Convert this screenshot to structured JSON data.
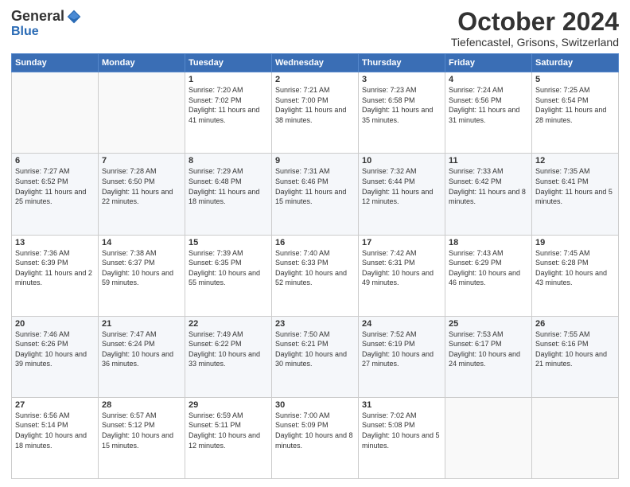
{
  "logo": {
    "general": "General",
    "blue": "Blue"
  },
  "header": {
    "month": "October 2024",
    "location": "Tiefencastel, Grisons, Switzerland"
  },
  "weekdays": [
    "Sunday",
    "Monday",
    "Tuesday",
    "Wednesday",
    "Thursday",
    "Friday",
    "Saturday"
  ],
  "weeks": [
    [
      {
        "day": "",
        "sunrise": "",
        "sunset": "",
        "daylight": ""
      },
      {
        "day": "",
        "sunrise": "",
        "sunset": "",
        "daylight": ""
      },
      {
        "day": "1",
        "sunrise": "Sunrise: 7:20 AM",
        "sunset": "Sunset: 7:02 PM",
        "daylight": "Daylight: 11 hours and 41 minutes."
      },
      {
        "day": "2",
        "sunrise": "Sunrise: 7:21 AM",
        "sunset": "Sunset: 7:00 PM",
        "daylight": "Daylight: 11 hours and 38 minutes."
      },
      {
        "day": "3",
        "sunrise": "Sunrise: 7:23 AM",
        "sunset": "Sunset: 6:58 PM",
        "daylight": "Daylight: 11 hours and 35 minutes."
      },
      {
        "day": "4",
        "sunrise": "Sunrise: 7:24 AM",
        "sunset": "Sunset: 6:56 PM",
        "daylight": "Daylight: 11 hours and 31 minutes."
      },
      {
        "day": "5",
        "sunrise": "Sunrise: 7:25 AM",
        "sunset": "Sunset: 6:54 PM",
        "daylight": "Daylight: 11 hours and 28 minutes."
      }
    ],
    [
      {
        "day": "6",
        "sunrise": "Sunrise: 7:27 AM",
        "sunset": "Sunset: 6:52 PM",
        "daylight": "Daylight: 11 hours and 25 minutes."
      },
      {
        "day": "7",
        "sunrise": "Sunrise: 7:28 AM",
        "sunset": "Sunset: 6:50 PM",
        "daylight": "Daylight: 11 hours and 22 minutes."
      },
      {
        "day": "8",
        "sunrise": "Sunrise: 7:29 AM",
        "sunset": "Sunset: 6:48 PM",
        "daylight": "Daylight: 11 hours and 18 minutes."
      },
      {
        "day": "9",
        "sunrise": "Sunrise: 7:31 AM",
        "sunset": "Sunset: 6:46 PM",
        "daylight": "Daylight: 11 hours and 15 minutes."
      },
      {
        "day": "10",
        "sunrise": "Sunrise: 7:32 AM",
        "sunset": "Sunset: 6:44 PM",
        "daylight": "Daylight: 11 hours and 12 minutes."
      },
      {
        "day": "11",
        "sunrise": "Sunrise: 7:33 AM",
        "sunset": "Sunset: 6:42 PM",
        "daylight": "Daylight: 11 hours and 8 minutes."
      },
      {
        "day": "12",
        "sunrise": "Sunrise: 7:35 AM",
        "sunset": "Sunset: 6:41 PM",
        "daylight": "Daylight: 11 hours and 5 minutes."
      }
    ],
    [
      {
        "day": "13",
        "sunrise": "Sunrise: 7:36 AM",
        "sunset": "Sunset: 6:39 PM",
        "daylight": "Daylight: 11 hours and 2 minutes."
      },
      {
        "day": "14",
        "sunrise": "Sunrise: 7:38 AM",
        "sunset": "Sunset: 6:37 PM",
        "daylight": "Daylight: 10 hours and 59 minutes."
      },
      {
        "day": "15",
        "sunrise": "Sunrise: 7:39 AM",
        "sunset": "Sunset: 6:35 PM",
        "daylight": "Daylight: 10 hours and 55 minutes."
      },
      {
        "day": "16",
        "sunrise": "Sunrise: 7:40 AM",
        "sunset": "Sunset: 6:33 PM",
        "daylight": "Daylight: 10 hours and 52 minutes."
      },
      {
        "day": "17",
        "sunrise": "Sunrise: 7:42 AM",
        "sunset": "Sunset: 6:31 PM",
        "daylight": "Daylight: 10 hours and 49 minutes."
      },
      {
        "day": "18",
        "sunrise": "Sunrise: 7:43 AM",
        "sunset": "Sunset: 6:29 PM",
        "daylight": "Daylight: 10 hours and 46 minutes."
      },
      {
        "day": "19",
        "sunrise": "Sunrise: 7:45 AM",
        "sunset": "Sunset: 6:28 PM",
        "daylight": "Daylight: 10 hours and 43 minutes."
      }
    ],
    [
      {
        "day": "20",
        "sunrise": "Sunrise: 7:46 AM",
        "sunset": "Sunset: 6:26 PM",
        "daylight": "Daylight: 10 hours and 39 minutes."
      },
      {
        "day": "21",
        "sunrise": "Sunrise: 7:47 AM",
        "sunset": "Sunset: 6:24 PM",
        "daylight": "Daylight: 10 hours and 36 minutes."
      },
      {
        "day": "22",
        "sunrise": "Sunrise: 7:49 AM",
        "sunset": "Sunset: 6:22 PM",
        "daylight": "Daylight: 10 hours and 33 minutes."
      },
      {
        "day": "23",
        "sunrise": "Sunrise: 7:50 AM",
        "sunset": "Sunset: 6:21 PM",
        "daylight": "Daylight: 10 hours and 30 minutes."
      },
      {
        "day": "24",
        "sunrise": "Sunrise: 7:52 AM",
        "sunset": "Sunset: 6:19 PM",
        "daylight": "Daylight: 10 hours and 27 minutes."
      },
      {
        "day": "25",
        "sunrise": "Sunrise: 7:53 AM",
        "sunset": "Sunset: 6:17 PM",
        "daylight": "Daylight: 10 hours and 24 minutes."
      },
      {
        "day": "26",
        "sunrise": "Sunrise: 7:55 AM",
        "sunset": "Sunset: 6:16 PM",
        "daylight": "Daylight: 10 hours and 21 minutes."
      }
    ],
    [
      {
        "day": "27",
        "sunrise": "Sunrise: 6:56 AM",
        "sunset": "Sunset: 5:14 PM",
        "daylight": "Daylight: 10 hours and 18 minutes."
      },
      {
        "day": "28",
        "sunrise": "Sunrise: 6:57 AM",
        "sunset": "Sunset: 5:12 PM",
        "daylight": "Daylight: 10 hours and 15 minutes."
      },
      {
        "day": "29",
        "sunrise": "Sunrise: 6:59 AM",
        "sunset": "Sunset: 5:11 PM",
        "daylight": "Daylight: 10 hours and 12 minutes."
      },
      {
        "day": "30",
        "sunrise": "Sunrise: 7:00 AM",
        "sunset": "Sunset: 5:09 PM",
        "daylight": "Daylight: 10 hours and 8 minutes."
      },
      {
        "day": "31",
        "sunrise": "Sunrise: 7:02 AM",
        "sunset": "Sunset: 5:08 PM",
        "daylight": "Daylight: 10 hours and 5 minutes."
      },
      {
        "day": "",
        "sunrise": "",
        "sunset": "",
        "daylight": ""
      },
      {
        "day": "",
        "sunrise": "",
        "sunset": "",
        "daylight": ""
      }
    ]
  ]
}
